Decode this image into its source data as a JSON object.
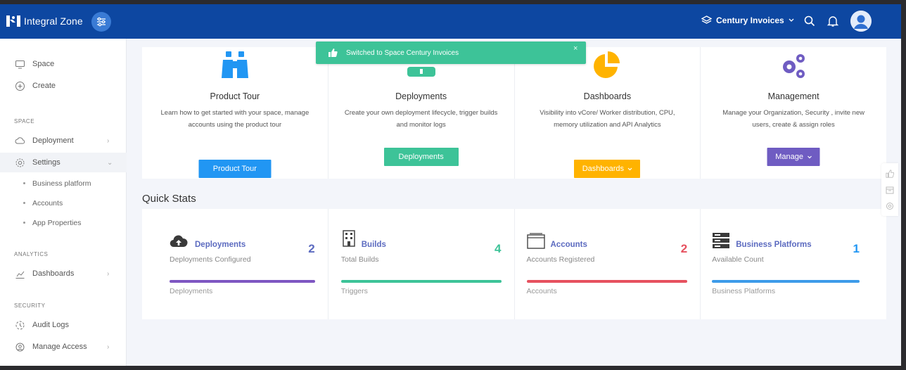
{
  "header": {
    "brand": "Integral Zone",
    "space_selector": "Century Invoices",
    "icons": [
      "logo-icon",
      "sliders-icon",
      "layers-icon",
      "search-icon",
      "notifications-icon",
      "user-avatar"
    ]
  },
  "sidebar": {
    "top_items": [
      {
        "label": "Space",
        "icon": "monitor-icon"
      },
      {
        "label": "Create",
        "icon": "plus-circle-icon"
      }
    ],
    "sections": [
      {
        "heading": "SPACE"
      },
      {
        "heading": "ANALYTICS"
      },
      {
        "heading": "SECURITY"
      }
    ],
    "space_items": [
      {
        "label": "Deployment",
        "icon": "cloud-icon",
        "chevron": "›"
      },
      {
        "label": "Settings",
        "icon": "gear-icon",
        "chevron": "⌄"
      }
    ],
    "settings_sub": [
      {
        "label": "Business platform"
      },
      {
        "label": "Accounts"
      },
      {
        "label": "App Properties"
      }
    ],
    "analytics_items": [
      {
        "label": "Dashboards",
        "icon": "chart-icon",
        "chevron": "›"
      }
    ],
    "security_items": [
      {
        "label": "Audit Logs",
        "icon": "audit-icon"
      },
      {
        "label": "Manage Access",
        "icon": "access-icon",
        "chevron": "›"
      }
    ]
  },
  "toast": {
    "text": "Switched to Space Century Invoices",
    "close": "×",
    "color": "#3dc398"
  },
  "features": [
    {
      "title": "Product Tour",
      "desc": "Learn how to get started with your space, manage accounts using the product tour",
      "button": "Product Tour",
      "color": "#2196f3",
      "icon": "binoculars-icon"
    },
    {
      "title": "Deployments",
      "desc": "Create your own deployment lifecycle, trigger builds and monitor logs",
      "button": "Deployments",
      "color": "#3dc398",
      "icon": "deploy-icon"
    },
    {
      "title": "Dashboards",
      "desc": "Visibility into vCore/ Worker distribution, CPU, memory utilization and API Analytics",
      "button": "Dashboards",
      "color": "#ffb300",
      "icon": "pie-chart-icon"
    },
    {
      "title": "Management",
      "desc": "Manage your Organization, Security , invite new users, create & assign roles",
      "button": "Manage",
      "color": "#6f5cc2",
      "icon": "gears-icon"
    }
  ],
  "quick_stats": {
    "title": "Quick Stats",
    "items": [
      {
        "name": "Deployments",
        "sub": "Deployments Configured",
        "value": "2",
        "footer": "Deployments",
        "color": "#5c6bc0",
        "bar": "#7e57c2",
        "icon": "cloud-upload-icon"
      },
      {
        "name": "Builds",
        "sub": "Total Builds",
        "value": "4",
        "footer": "Triggers",
        "color": "#3dc398",
        "bar": "#3dc398",
        "icon": "building-icon"
      },
      {
        "name": "Accounts",
        "sub": "Accounts Registered",
        "value": "2",
        "footer": "Accounts",
        "color": "#e6515f",
        "bar": "#e6515f",
        "icon": "window-icon"
      },
      {
        "name": "Business Platforms",
        "sub": "Available Count",
        "value": "1",
        "footer": "Business Platforms",
        "color": "#2196f3",
        "bar": "#3d9be9",
        "icon": "server-icon"
      }
    ]
  },
  "rail_icons": [
    "thumbs-up-icon",
    "calendar-icon",
    "settings-icon"
  ]
}
